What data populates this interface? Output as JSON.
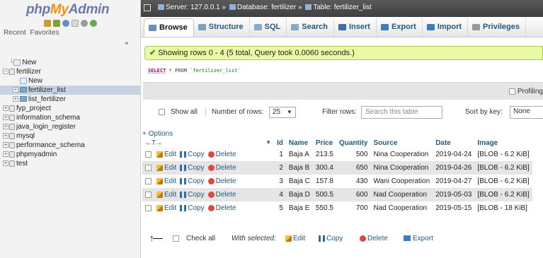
{
  "app": {
    "logo_php": "php",
    "logo_my": "My",
    "logo_admin": "Admin"
  },
  "sidebar": {
    "recent": "Recent",
    "favorites": "Favorites",
    "new_label": "New",
    "tree": [
      {
        "label": "fertilizer",
        "level": 0,
        "kind": "db",
        "expanded": true
      },
      {
        "label": "New",
        "level": 1,
        "kind": "new"
      },
      {
        "label": "fertilizer_list",
        "level": 1,
        "kind": "table",
        "selected": true
      },
      {
        "label": "list_fertilizer",
        "level": 1,
        "kind": "table"
      },
      {
        "label": "fyp_project",
        "level": 0,
        "kind": "db"
      },
      {
        "label": "information_schema",
        "level": 0,
        "kind": "db"
      },
      {
        "label": "java_login_register",
        "level": 0,
        "kind": "db"
      },
      {
        "label": "mysql",
        "level": 0,
        "kind": "db"
      },
      {
        "label": "performance_schema",
        "level": 0,
        "kind": "db"
      },
      {
        "label": "phpmyadmin",
        "level": 0,
        "kind": "db"
      },
      {
        "label": "test",
        "level": 0,
        "kind": "db"
      }
    ]
  },
  "breadcrumb": {
    "server": "Server: 127.0.0.1",
    "database": "Database: fertilizer",
    "table": "Table: fertilizer_list",
    "sep": "»"
  },
  "tabs": [
    {
      "label": "Browse",
      "active": true,
      "icon_color": "#6b8fbd"
    },
    {
      "label": "Structure",
      "icon_color": "#7aa0c8"
    },
    {
      "label": "SQL",
      "icon_color": "#8aa8c8"
    },
    {
      "label": "Search",
      "icon_color": "#8aa8c8"
    },
    {
      "label": "Insert",
      "icon_color": "#3a6ea5"
    },
    {
      "label": "Export",
      "icon_color": "#3a7dc0"
    },
    {
      "label": "Import",
      "icon_color": "#3a7dc0"
    },
    {
      "label": "Privileges",
      "icon_color": "#999999"
    }
  ],
  "message": "Showing rows 0 - 4 (5 total, Query took 0.0060 seconds.)",
  "sql": {
    "kw1": "SELECT",
    "mid": " * FROM ",
    "table": "`fertilizer_list`"
  },
  "profiling": "Profiling",
  "controls": {
    "show_all": "Show all",
    "num_rows_label": "Number of rows:",
    "num_rows_value": "25",
    "filter_label": "Filter rows:",
    "filter_placeholder": "Search this table",
    "sort_label": "Sort by key:",
    "sort_value": "None"
  },
  "options_link": "+ Options",
  "arrows": "←T→",
  "columns": [
    "Id",
    "Name",
    "Price",
    "Quantity",
    "Source",
    "Date",
    "Image"
  ],
  "actions": {
    "edit": "Edit",
    "copy": "Copy",
    "delete": "Delete"
  },
  "rows": [
    {
      "id": "1",
      "name": "Baja A",
      "price": "213.5",
      "quantity": "500",
      "source": "Nina Cooperation",
      "date": "2019-04-24",
      "image": "[BLOB - 6.2 KiB]"
    },
    {
      "id": "2",
      "name": "Baja B",
      "price": "300.4",
      "quantity": "650",
      "source": "Nina Cooperation",
      "date": "2019-04-26",
      "image": "[BLOB - 6.2 KiB]"
    },
    {
      "id": "3",
      "name": "Baja C",
      "price": "157.8",
      "quantity": "430",
      "source": "Wani Cooperation",
      "date": "2019-04-27",
      "image": "[BLOB - 6.2 KiB]"
    },
    {
      "id": "4",
      "name": "Baja D",
      "price": "500.5",
      "quantity": "600",
      "source": "Nad Cooperation",
      "date": "2019-05-03",
      "image": "[BLOB - 6.2 KiB]"
    },
    {
      "id": "5",
      "name": "Baja E",
      "price": "550.5",
      "quantity": "700",
      "source": "Nad Cooperation",
      "date": "2019-05-15",
      "image": "[BLOB - 18 KiB]"
    }
  ],
  "footer": {
    "check_all": "Check all",
    "with_selected": "With selected:",
    "edit": "Edit",
    "copy": "Copy",
    "delete": "Delete",
    "export": "Export"
  }
}
